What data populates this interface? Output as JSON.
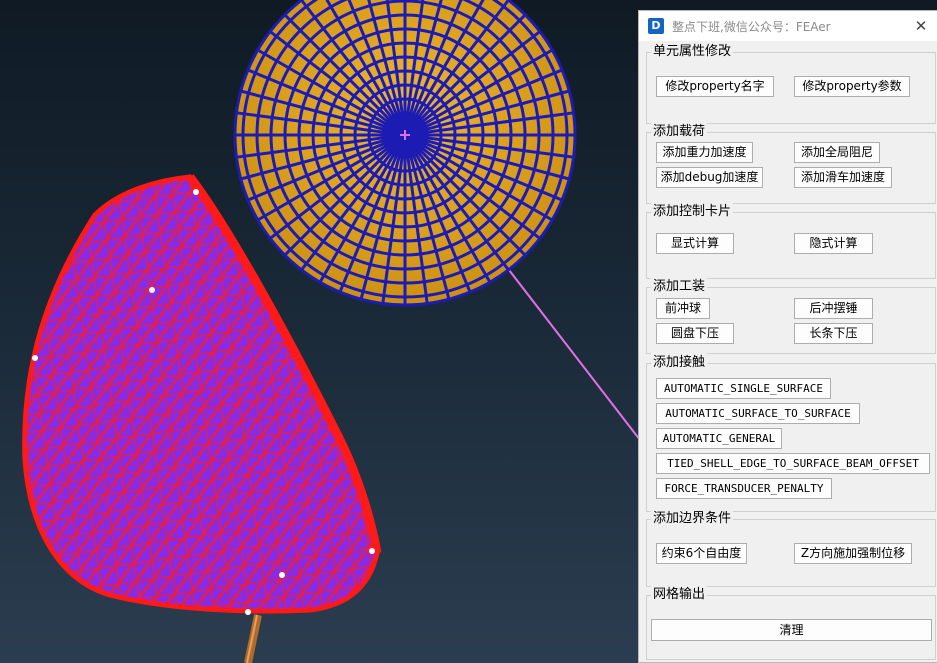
{
  "window": {
    "title": "整点下班,微信公众号：FEAer",
    "app_icon": "app-logo-icon",
    "close_label": "✕"
  },
  "groups": {
    "element_property": {
      "title": "单元属性修改",
      "buttons": [
        "修改property名字",
        "修改property参数"
      ]
    },
    "add_load": {
      "title": "添加载荷",
      "buttons": [
        "添加重力加速度",
        "添加全局阻尼",
        "添加debug加速度",
        "添加滑车加速度"
      ]
    },
    "control_card": {
      "title": "添加控制卡片",
      "buttons": [
        "显式计算",
        "隐式计算"
      ]
    },
    "fixture": {
      "title": "添加工装",
      "buttons": [
        "前冲球",
        "后冲摆锤",
        "圆盘下压",
        "长条下压"
      ]
    },
    "contact": {
      "title": "添加接触",
      "buttons": [
        "AUTOMATIC_SINGLE_SURFACE",
        "AUTOMATIC_SURFACE_TO_SURFACE",
        "AUTOMATIC_GENERAL",
        "TIED_SHELL_EDGE_TO_SURFACE_BEAM_OFFSET",
        "FORCE_TRANSDUCER_PENALTY"
      ]
    },
    "boundary": {
      "title": "添加边界条件",
      "buttons": [
        "约束6个自由度",
        "Z方向施加强制位移"
      ]
    },
    "mesh_output": {
      "title": "网格输出",
      "buttons": [
        "清理"
      ]
    }
  },
  "viewport": {
    "sphere_fill": "#e3a81d",
    "sphere_mesh": "#1c1cb4",
    "part_fill": "#8a2be2",
    "part_mesh": "#ff1a1a",
    "beam_line": "#e070e8"
  }
}
